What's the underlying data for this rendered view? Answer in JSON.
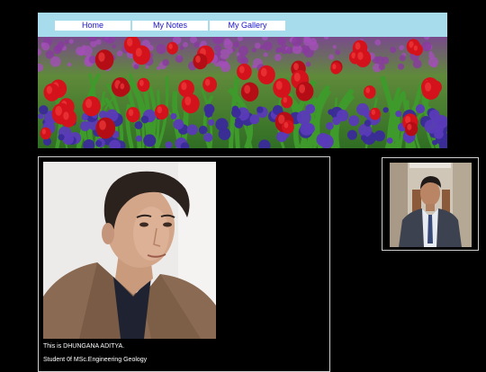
{
  "nav": {
    "home_label": "Home",
    "notes_label": "My Notes",
    "gallery_label": "My Gallery"
  },
  "banner": {
    "image": "tulip-field-banner"
  },
  "profile": {
    "line1": "This is DHUNGANA ADITYA.",
    "line2": "Student 0f MSc.Engineering Geology"
  },
  "colors": {
    "topbar": "#a6dcec",
    "nav_text": "#1b14c8",
    "page_background": "#000000"
  }
}
